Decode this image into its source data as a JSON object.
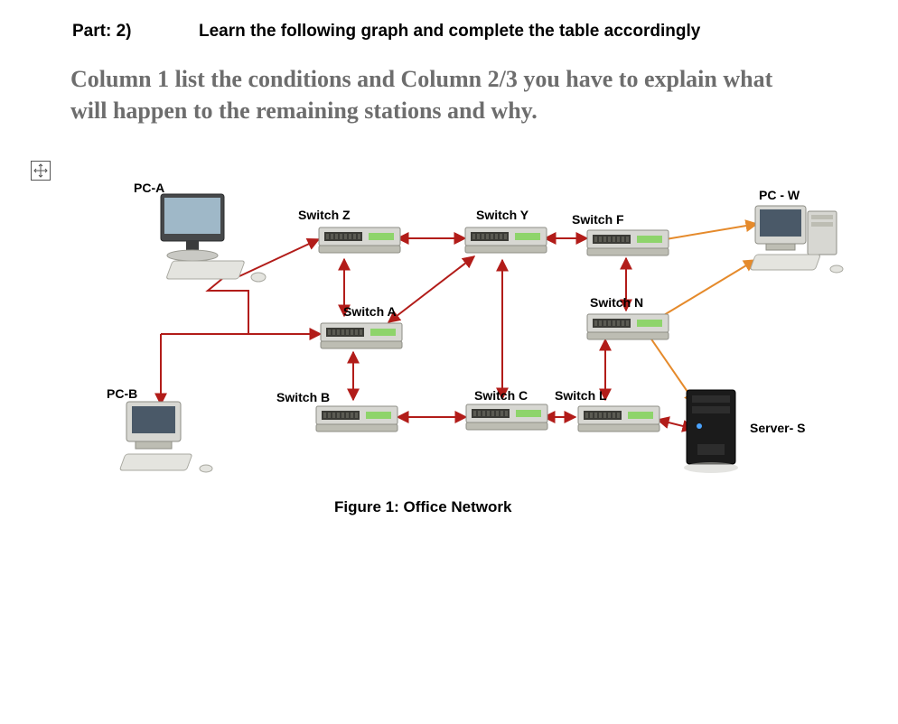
{
  "heading": {
    "part": "Part: 2)",
    "learn": "Learn the following graph and complete the table accordingly"
  },
  "subtitle": "Column 1 list the conditions and Column 2/3 you have to explain what will happen to the remaining stations and why.",
  "caption": "Figure 1: Office Network",
  "labels": {
    "pcA": "PC-A",
    "pcB": "PC-B",
    "pcW": "PC - W",
    "serverS": "Server- S",
    "switchZ": "Switch Z",
    "switchY": "Switch Y",
    "switchF": "Switch F",
    "switchA": "Switch A",
    "switchN": "Switch N",
    "switchB": "Switch B",
    "switchC": "Switch C",
    "switchL": "Switch L"
  },
  "diagram": {
    "type": "network-topology",
    "nodes": [
      {
        "id": "PC-A",
        "kind": "desktop-pc",
        "connects_to": [
          "SwitchZ",
          "SwitchA"
        ]
      },
      {
        "id": "PC-B",
        "kind": "desktop-pc",
        "connects_to": [
          "SwitchA"
        ],
        "note": "shares link segment with PC-A"
      },
      {
        "id": "PC-W",
        "kind": "desktop-pc",
        "connects_to": [
          "SwitchF",
          "SwitchN"
        ]
      },
      {
        "id": "Server-S",
        "kind": "server",
        "connects_to": [
          "SwitchL",
          "SwitchN"
        ]
      },
      {
        "id": "SwitchZ",
        "kind": "switch",
        "connects_to": [
          "SwitchY",
          "SwitchA",
          "PC-A"
        ]
      },
      {
        "id": "SwitchY",
        "kind": "switch",
        "connects_to": [
          "SwitchZ",
          "SwitchF",
          "SwitchA",
          "SwitchC"
        ]
      },
      {
        "id": "SwitchF",
        "kind": "switch",
        "connects_to": [
          "SwitchY",
          "SwitchN",
          "PC-W"
        ]
      },
      {
        "id": "SwitchA",
        "kind": "switch",
        "connects_to": [
          "SwitchZ",
          "SwitchY",
          "SwitchB",
          "PC-A",
          "PC-B"
        ]
      },
      {
        "id": "SwitchN",
        "kind": "switch",
        "connects_to": [
          "SwitchF",
          "SwitchL",
          "PC-W",
          "Server-S"
        ]
      },
      {
        "id": "SwitchB",
        "kind": "switch",
        "connects_to": [
          "SwitchA",
          "SwitchC"
        ]
      },
      {
        "id": "SwitchC",
        "kind": "switch",
        "connects_to": [
          "SwitchY",
          "SwitchB",
          "SwitchL"
        ]
      },
      {
        "id": "SwitchL",
        "kind": "switch",
        "connects_to": [
          "SwitchC",
          "SwitchN",
          "Server-S"
        ]
      }
    ]
  }
}
